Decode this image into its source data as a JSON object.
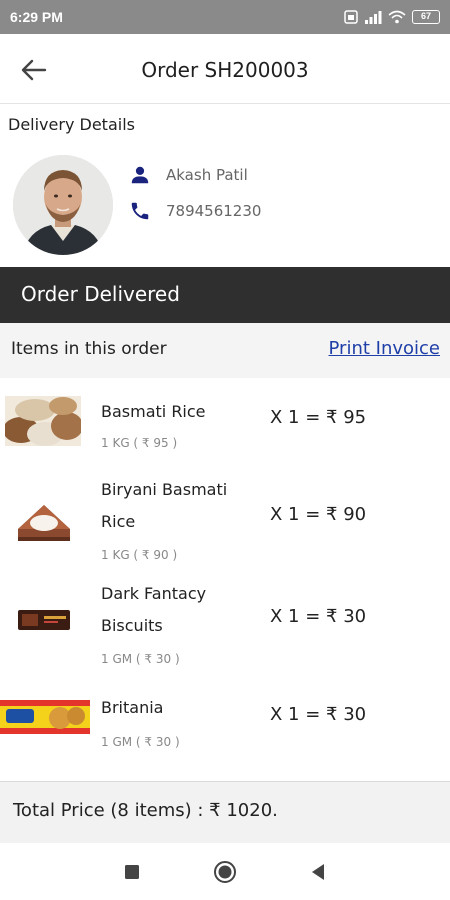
{
  "status_bar": {
    "time": "6:29 PM",
    "battery": "67"
  },
  "header": {
    "title": "Order SH200003",
    "back_icon": "arrow-left-icon"
  },
  "delivery": {
    "heading": "Delivery Details",
    "name": "Akash Patil",
    "phone": "7894561230",
    "person_icon": "person-icon",
    "phone_icon": "phone-icon"
  },
  "order_status": "Order Delivered",
  "items_section": {
    "heading": "Items in this order",
    "print_invoice": "Print Invoice"
  },
  "items": [
    {
      "name": "Basmati Rice",
      "unit": "1 KG ( ₹ 95 )",
      "qty": "X  1 = ₹ 95"
    },
    {
      "name": "Biryani Basmati Rice",
      "unit": "1 KG ( ₹ 90 )",
      "qty": "X  1 = ₹ 90"
    },
    {
      "name": "Dark Fantacy Biscuits",
      "unit": "1 GM ( ₹ 30 )",
      "qty": "X  1 = ₹ 30"
    },
    {
      "name": "Britania",
      "unit": "1 GM ( ₹ 30 )",
      "qty": "X  1 = ₹ 30"
    }
  ],
  "total": "Total Price (8 items) :  ₹ 1020.",
  "colors": {
    "banner": "#2f2f2f",
    "link": "#1f3fa8",
    "icon": "#1a237e",
    "status_bar": "#8a8a8a"
  },
  "nav": {
    "recents_icon": "square-recents-icon",
    "home_icon": "circle-home-icon",
    "back_icon": "triangle-back-icon"
  }
}
